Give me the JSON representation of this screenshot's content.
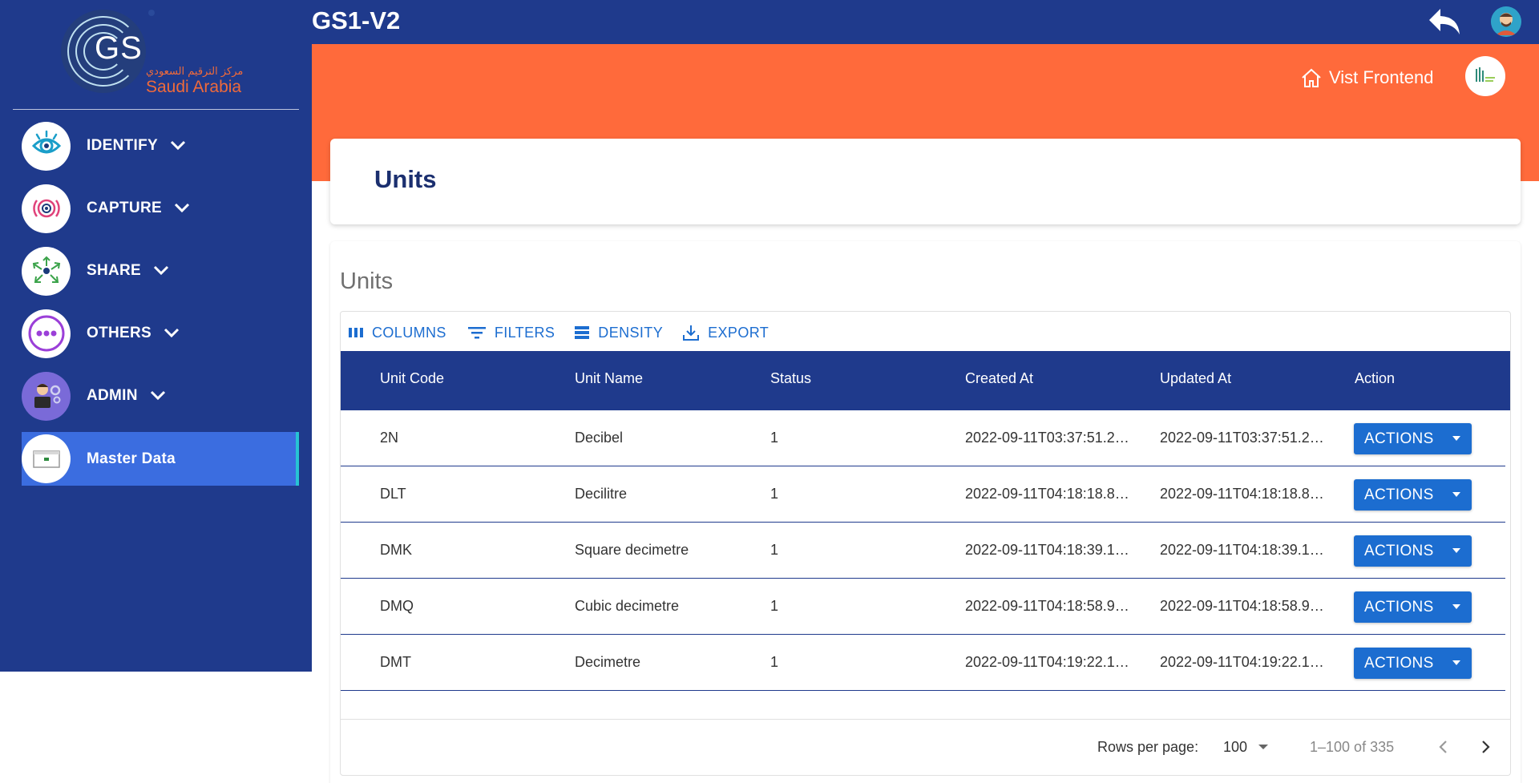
{
  "app": {
    "title": "GS1-V2"
  },
  "logo": {
    "mark": "GS",
    "arabic": "مركز الترقيم السعودي",
    "region": "Saudi Arabia"
  },
  "sidebar": {
    "items": [
      {
        "label": "IDENTIFY",
        "icon": "eye-icon"
      },
      {
        "label": "CAPTURE",
        "icon": "target-icon"
      },
      {
        "label": "SHARE",
        "icon": "share-nodes-icon"
      },
      {
        "label": "OTHERS",
        "icon": "more-dots-icon"
      },
      {
        "label": "ADMIN",
        "icon": "admin-avatar-icon"
      },
      {
        "label": "Master Data",
        "icon": "master-data-icon",
        "active": true
      }
    ]
  },
  "header": {
    "visit_frontend": "Vist Frontend"
  },
  "page": {
    "title": "Units",
    "section_title": "Units"
  },
  "toolbar": {
    "columns": "COLUMNS",
    "filters": "FILTERS",
    "density": "DENSITY",
    "export": "EXPORT"
  },
  "table": {
    "headers": [
      "Unit Code",
      "Unit Name",
      "Status",
      "Created At",
      "Updated At",
      "Action"
    ],
    "rows": [
      {
        "code": "2N",
        "name": "Decibel",
        "status": "1",
        "created": "2022-09-11T03:37:51.2…",
        "updated": "2022-09-11T03:37:51.2…",
        "action": "ACTIONS"
      },
      {
        "code": "DLT",
        "name": "Decilitre",
        "status": "1",
        "created": "2022-09-11T04:18:18.8…",
        "updated": "2022-09-11T04:18:18.8…",
        "action": "ACTIONS"
      },
      {
        "code": "DMK",
        "name": "Square decimetre",
        "status": "1",
        "created": "2022-09-11T04:18:39.1…",
        "updated": "2022-09-11T04:18:39.1…",
        "action": "ACTIONS"
      },
      {
        "code": "DMQ",
        "name": "Cubic decimetre",
        "status": "1",
        "created": "2022-09-11T04:18:58.9…",
        "updated": "2022-09-11T04:18:58.9…",
        "action": "ACTIONS"
      },
      {
        "code": "DMT",
        "name": "Decimetre",
        "status": "1",
        "created": "2022-09-11T04:19:22.1…",
        "updated": "2022-09-11T04:19:22.1…",
        "action": "ACTIONS"
      }
    ]
  },
  "pagination": {
    "rows_per_page_label": "Rows per page:",
    "rows_per_page": "100",
    "range": "1–100 of 335"
  },
  "colors": {
    "navy": "#1f3a8c",
    "orange": "#ff6a3b",
    "accent_blue": "#1c6dd0",
    "active_item": "#3b6de0"
  }
}
